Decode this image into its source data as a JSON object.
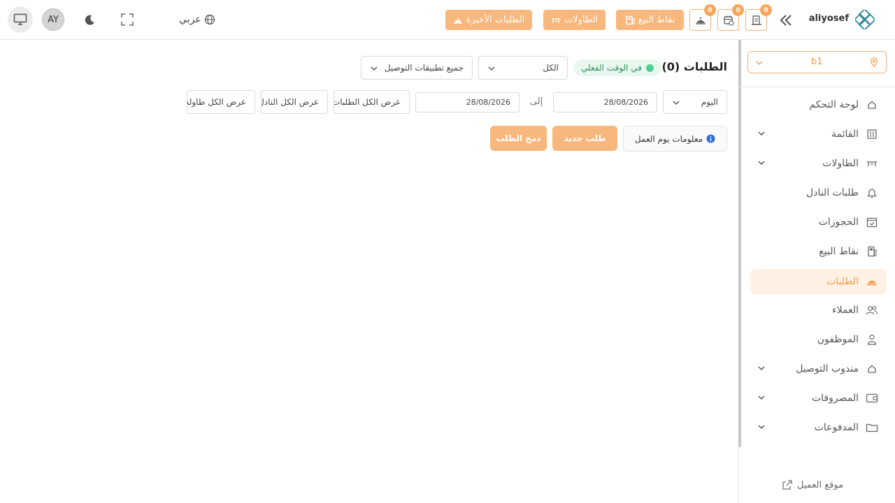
{
  "brand": {
    "username": "aliyosef"
  },
  "topbar": {
    "recent_orders": "الطلبات الأخيرة",
    "tables": "الطاولات",
    "pos": "نقاط البيع",
    "badge_orders": "0",
    "badge_calendar": "0",
    "badge_waiter": "0",
    "language": "عربي",
    "avatar": "AY"
  },
  "sidebar": {
    "branch": "b1",
    "items": [
      {
        "label": "لوحة التحكم"
      },
      {
        "label": "القائمة"
      },
      {
        "label": "الطاولات"
      },
      {
        "label": "طلبات النادل"
      },
      {
        "label": "الحجوزات"
      },
      {
        "label": "نقاط البيع"
      },
      {
        "label": "الطلبات"
      },
      {
        "label": "العملاء"
      },
      {
        "label": "الموظفون"
      },
      {
        "label": "مندوب التوصيل"
      },
      {
        "label": "المصروفات"
      },
      {
        "label": "المدفوعات"
      }
    ],
    "customer_site": "موقع العميل"
  },
  "main": {
    "title": "الطلبات (0)",
    "realtime": "في الوقت الفعلي",
    "filter_all": "الكل",
    "delivery_apps": "جميع تطبيقات التوصيل",
    "date_range": "اليوم",
    "date_from": "28/08/2026",
    "to_label": "إلى",
    "date_to": "28/08/2026",
    "show_all_orders": "عرض الكل الطلبات",
    "show_all_waiters": "عرض الكل النادل",
    "show_all_tables": "عرض الكل طاولة",
    "workday_info": "معلومات يوم العمل",
    "new_order": "طلب جديد",
    "merge_order": "دمج الطلب"
  },
  "colors": {
    "accent": "#f8b77c",
    "accent_dark": "#f0a050",
    "live": "#4fcf8f"
  }
}
